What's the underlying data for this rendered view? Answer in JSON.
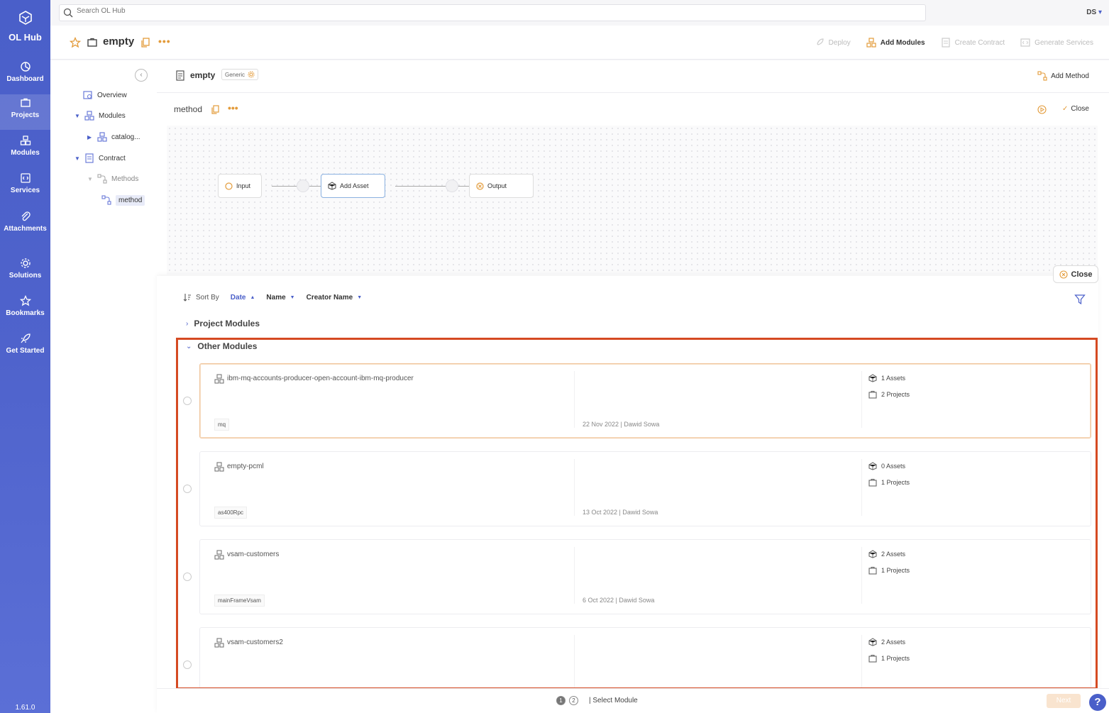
{
  "app": {
    "name": "OL Hub",
    "version": "1.61.0"
  },
  "sidebar": {
    "items": [
      {
        "label": "Dashboard",
        "icon": "dashboard-icon"
      },
      {
        "label": "Projects",
        "icon": "briefcase-icon",
        "active": true
      },
      {
        "label": "Modules",
        "icon": "modules-icon"
      },
      {
        "label": "Services",
        "icon": "services-icon"
      },
      {
        "label": "Attachments",
        "icon": "paperclip-icon"
      },
      {
        "label": "Solutions",
        "icon": "gear-icon"
      },
      {
        "label": "Bookmarks",
        "icon": "star-icon"
      },
      {
        "label": "Get Started",
        "icon": "rocket-icon"
      }
    ]
  },
  "search": {
    "placeholder": "Search OL Hub"
  },
  "user": {
    "initials": "DS"
  },
  "project": {
    "title": "empty",
    "more": "•••",
    "actions": [
      {
        "label": "Deploy",
        "enabled": false
      },
      {
        "label": "Add Modules",
        "enabled": true
      },
      {
        "label": "Create Contract",
        "enabled": false
      },
      {
        "label": "Generate Services",
        "enabled": false
      }
    ]
  },
  "tree": {
    "items": [
      {
        "label": "Overview"
      },
      {
        "label": "Modules"
      },
      {
        "label": "catalog..."
      },
      {
        "label": "Contract"
      },
      {
        "label": "Methods"
      },
      {
        "label": "method"
      }
    ]
  },
  "contract": {
    "name": "empty",
    "tag": "Generic",
    "add_method": "Add Method"
  },
  "method": {
    "name": "method",
    "more": "•••",
    "close": "Close"
  },
  "flow": {
    "nodes": [
      "Input",
      "Add Asset",
      "Output"
    ]
  },
  "modal": {
    "close": "Close",
    "sort_by": "Sort By",
    "sort_options": [
      {
        "label": "Date",
        "active": true
      },
      {
        "label": "Name",
        "active": false
      },
      {
        "label": "Creator Name",
        "active": false
      }
    ],
    "sections": {
      "project": "Project Modules",
      "other": "Other Modules"
    },
    "modules": [
      {
        "name": "ibm-mq-accounts-producer-open-account-ibm-mq-producer",
        "type": "mq",
        "meta": "22 Nov 2022 | Dawid Sowa",
        "assets": "1 Assets",
        "projects": "2 Projects"
      },
      {
        "name": "empty-pcml",
        "type": "as400Rpc",
        "meta": "13 Oct 2022 | Dawid Sowa",
        "assets": "0 Assets",
        "projects": "1 Projects"
      },
      {
        "name": "vsam-customers",
        "type": "mainFrameVsam",
        "meta": "6 Oct 2022 | Dawid Sowa",
        "assets": "2 Assets",
        "projects": "1 Projects"
      },
      {
        "name": "vsam-customers2",
        "type": "",
        "meta": "",
        "assets": "2 Assets",
        "projects": "1 Projects"
      }
    ]
  },
  "footer": {
    "steps": [
      "1",
      "2"
    ],
    "select_module": "|  Select Module",
    "next": "Next"
  },
  "colors": {
    "sidebar": "#4a5fc9",
    "accent": "#e39b3a",
    "highlight": "#d54a22"
  }
}
